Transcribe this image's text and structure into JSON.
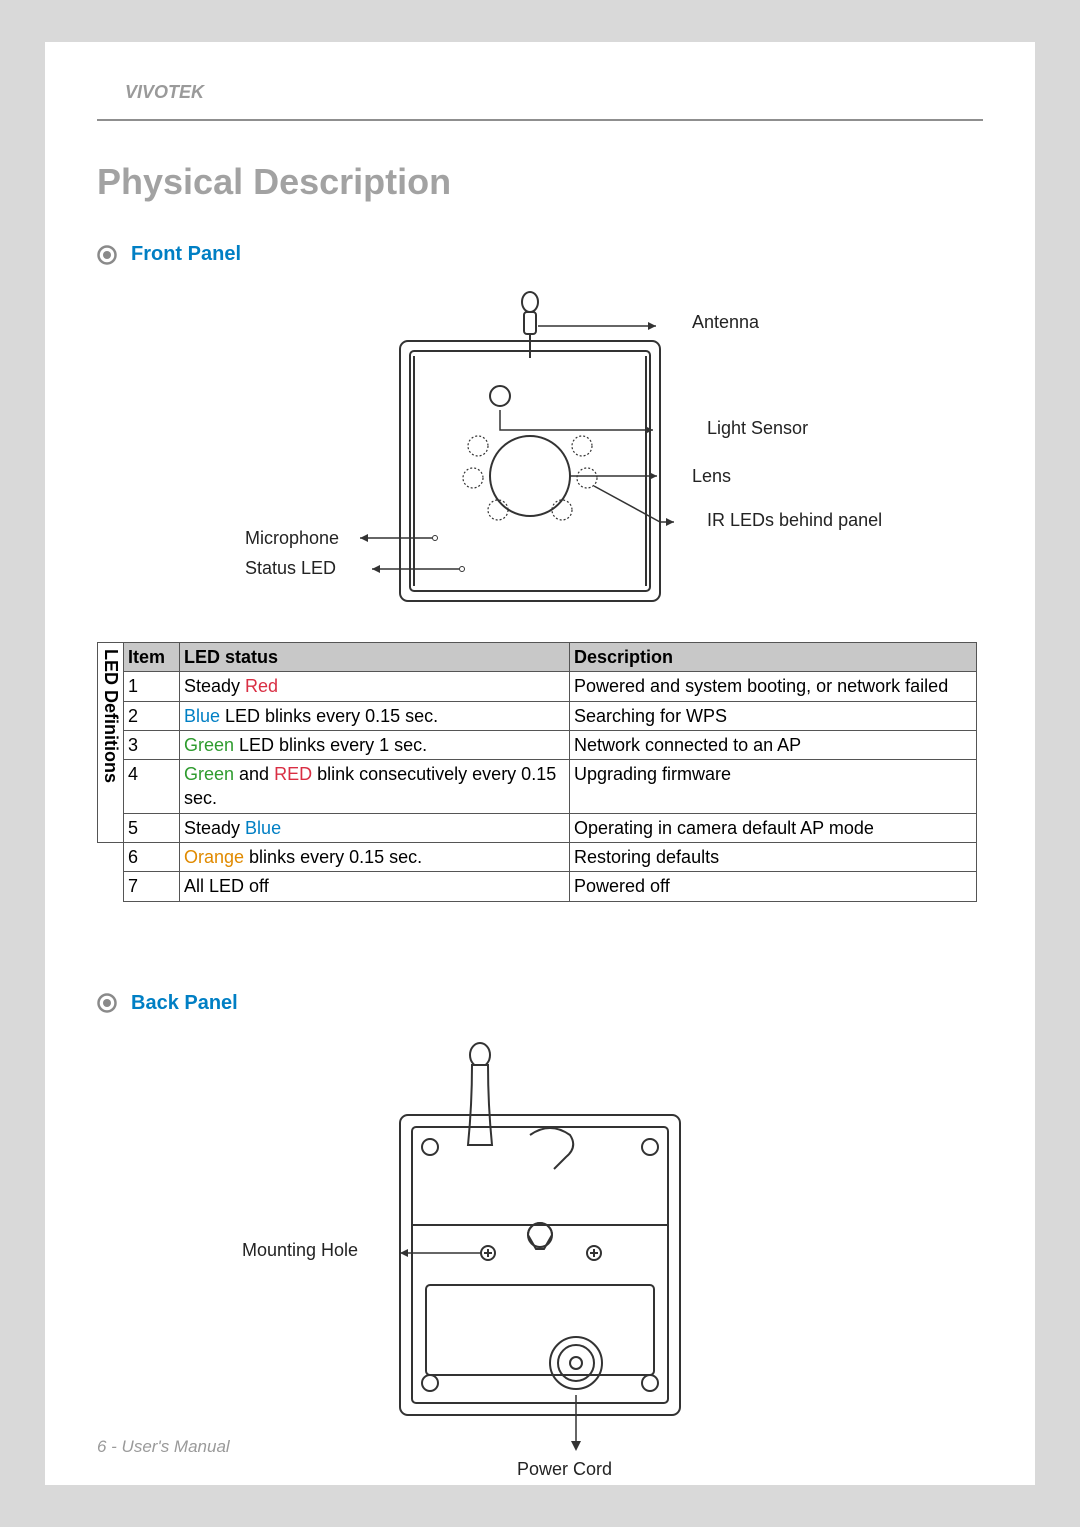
{
  "brand": "VIVOTEK",
  "page_title": "Physical Description",
  "sections": {
    "front": "Front Panel",
    "back": "Back Panel"
  },
  "front_callouts": {
    "antenna": "Antenna",
    "light_sensor": "Light Sensor",
    "lens": "Lens",
    "ir_leds": "IR LEDs behind panel",
    "microphone": "Microphone",
    "status_led": "Status LED"
  },
  "table": {
    "side_label": "LED Definitions",
    "headers": {
      "item": "Item",
      "led_status": "LED status",
      "description": "Description"
    },
    "rows": [
      {
        "item": "1",
        "status_pre": "Steady ",
        "status_color_word": "Red",
        "status_color_class": "c-red",
        "status_post": "",
        "desc": "Powered and system booting, or network failed"
      },
      {
        "item": "2",
        "status_pre": "",
        "status_color_word": "Blue",
        "status_color_class": "c-blue",
        "status_post": " LED blinks every 0.15 sec.",
        "desc": "Searching for WPS"
      },
      {
        "item": "3",
        "status_pre": "",
        "status_color_word": "Green",
        "status_color_class": "c-green",
        "status_post": " LED blinks every 1 sec.",
        "desc": "Network connected to an AP"
      },
      {
        "item": "4",
        "status_pre": "",
        "status_color_word": "Green",
        "status_color_class": "c-green",
        "status_mid": " and ",
        "status_color_word2": "RED",
        "status_color_class2": "c-red",
        "status_post2": " blink consecutively every 0.15 sec.",
        "desc": "Upgrading firmware"
      },
      {
        "item": "5",
        "status_pre": "Steady ",
        "status_color_word": "Blue",
        "status_color_class": "c-blue",
        "status_post": "",
        "desc": "Operating in camera default AP mode"
      },
      {
        "item": "6",
        "status_pre": "",
        "status_color_word": "Orange",
        "status_color_class": "c-orange",
        "status_post": " blinks every 0.15 sec.",
        "desc": "Restoring defaults"
      },
      {
        "item": "7",
        "status_pre": "All LED off",
        "status_color_word": "",
        "status_color_class": "",
        "status_post": "",
        "desc": "Powered off"
      }
    ]
  },
  "back_callouts": {
    "mounting_hole": "Mounting Hole",
    "power_cord": "Power Cord"
  },
  "footer": "6 - User's Manual"
}
